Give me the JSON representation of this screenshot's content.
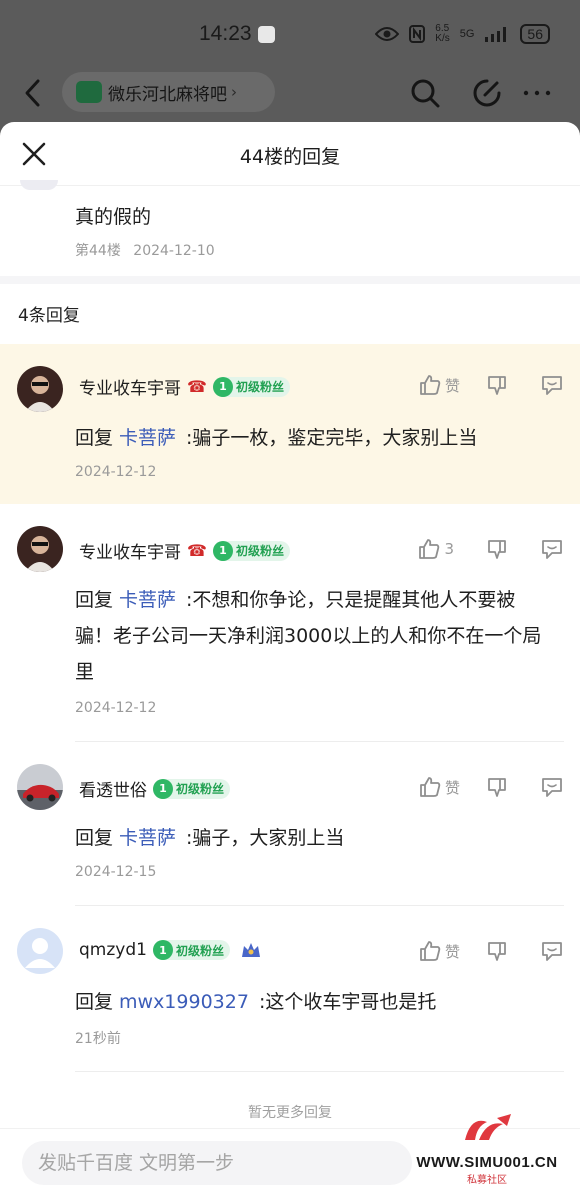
{
  "status_bar": {
    "time": "14:23",
    "net_speed": "6.5\nK/s",
    "signal": "5G",
    "battery": "56"
  },
  "nav": {
    "forum_name": "微乐河北麻将吧"
  },
  "sheet": {
    "title": "44楼的回复"
  },
  "original_post": {
    "text": "真的假的",
    "floor": "第44楼",
    "date": "2024-12-10"
  },
  "replies_count": "4条回复",
  "reply_prefix": "回复",
  "fan_level": "1",
  "fan_label": "初级粉丝",
  "replies": [
    {
      "user": "专业收车宇哥",
      "mention": "卡菩萨",
      "text": ":骗子一枚，鉴定完毕，大家别上当",
      "date": "2024-12-12",
      "likes": "赞"
    },
    {
      "user": "专业收车宇哥",
      "mention": "卡菩萨",
      "text": ":不想和你争论，只是提醒其他人不要被骗！老子公司一天净利润3000以上的人和你不在一个局里",
      "date": "2024-12-12",
      "likes": "3"
    },
    {
      "user": "看透世俗",
      "mention": "卡菩萨",
      "text": ":骗子，大家别上当",
      "date": "2024-12-15",
      "likes": "赞"
    },
    {
      "user": "qmzyd1",
      "mention": "mwx1990327",
      "text": ":这个收车宇哥也是托",
      "date": "21秒前",
      "likes": "赞"
    }
  ],
  "footer": {
    "no_more": "暂无更多回复",
    "composer_placeholder": "发贴千百度 文明第一步"
  },
  "watermark": {
    "site": "WWW.SIMU001.CN",
    "label": "私募社区"
  },
  "colors": {
    "mention": "#3b5cb8",
    "highlight_bg": "#fdf7e6",
    "fan_green": "#2fb765",
    "muted": "#9a9a9a"
  }
}
